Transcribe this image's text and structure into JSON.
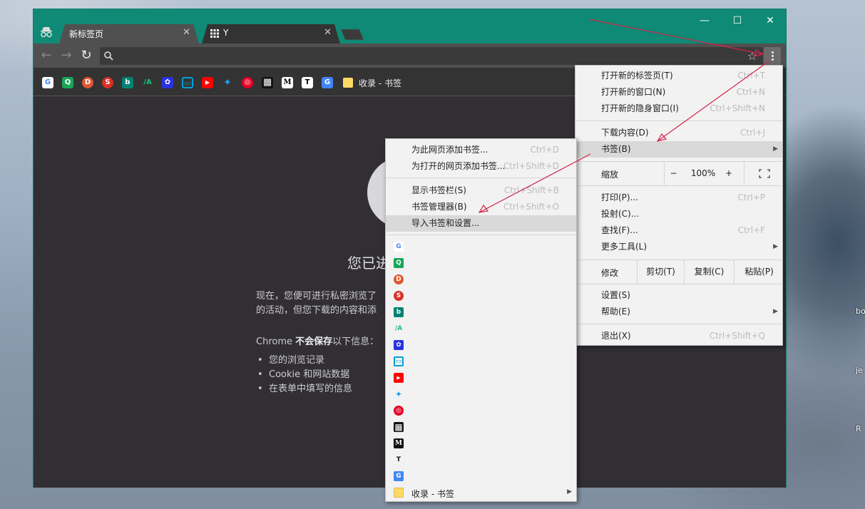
{
  "tabs": [
    {
      "title": "新标签页",
      "active": true
    },
    {
      "title": "Y",
      "active": false
    }
  ],
  "window_controls": {
    "minimize": "—",
    "maximize": "☐",
    "close": "✕"
  },
  "toolbar": {
    "back": "←",
    "forward": "→",
    "reload": "↻",
    "omnibox_value": ""
  },
  "bookmarks_bar": {
    "items": [
      {
        "icon": "google-icon",
        "glyph": "G",
        "color": "#ffffff"
      },
      {
        "icon": "green-q-icon",
        "glyph": "Q",
        "color": "#18a558"
      },
      {
        "icon": "duckduckgo-icon",
        "glyph": "D",
        "color": "#de5833"
      },
      {
        "icon": "red-s-icon",
        "glyph": "S",
        "color": "#d93025"
      },
      {
        "icon": "bing-icon",
        "glyph": "b",
        "color": "#008373"
      },
      {
        "icon": "ia-icon",
        "glyph": "/A",
        "color": "#333333"
      },
      {
        "icon": "baidu-icon",
        "glyph": "✿",
        "color": "#2932e1"
      },
      {
        "icon": "bilibili-icon",
        "glyph": "▭",
        "color": "#00a1d6"
      },
      {
        "icon": "youtube-icon",
        "glyph": "▶",
        "color": "#ff0000"
      },
      {
        "icon": "twitter-icon",
        "glyph": "✦",
        "color": "#1da1f2"
      },
      {
        "icon": "netease-music-icon",
        "glyph": "◎",
        "color": "#e60026"
      },
      {
        "icon": "grid-icon",
        "glyph": "▦",
        "color": "#111111"
      },
      {
        "icon": "medium-icon",
        "glyph": "M",
        "color": "#000000"
      },
      {
        "icon": "t-icon",
        "glyph": "T",
        "color": "#ffffff"
      },
      {
        "icon": "translate-icon",
        "glyph": "G",
        "color": "#4285f4"
      }
    ],
    "folder_label": "收录 - 书签"
  },
  "incognito_page": {
    "title": "您已进",
    "para1_line1": "现在，您便可进行私密浏览了",
    "para1_line2": "的活动，但您下载的内容和添",
    "para2_prefix": "Chrome ",
    "para2_bold": "不会保存",
    "para2_suffix": "以下信息：",
    "list": [
      "您的浏览记录",
      "Cookie 和网站数据",
      "在表单中填写的信息"
    ]
  },
  "main_menu": {
    "items": [
      {
        "label": "打开新的标签页(T)",
        "shortcut": "Ctrl+T"
      },
      {
        "label": "打开新的窗口(N)",
        "shortcut": "Ctrl+N"
      },
      {
        "label": "打开新的隐身窗口(I)",
        "shortcut": "Ctrl+Shift+N"
      },
      {
        "label": "下载内容(D)",
        "shortcut": "Ctrl+J"
      },
      {
        "label": "书签(B)",
        "shortcut": ""
      },
      {
        "label": "打印(P)...",
        "shortcut": "Ctrl+P"
      },
      {
        "label": "投射(C)...",
        "shortcut": ""
      },
      {
        "label": "查找(F)...",
        "shortcut": "Ctrl+F"
      },
      {
        "label": "更多工具(L)",
        "shortcut": ""
      },
      {
        "label": "设置(S)",
        "shortcut": ""
      },
      {
        "label": "帮助(E)",
        "shortcut": ""
      },
      {
        "label": "退出(X)",
        "shortcut": "Ctrl+Shift+Q"
      }
    ],
    "zoom": {
      "label": "缩放",
      "minus": "−",
      "value": "100%",
      "plus": "+"
    },
    "edit": {
      "label": "修改",
      "cut": "剪切(T)",
      "copy": "复制(C)",
      "paste": "粘贴(P)"
    }
  },
  "bookmark_submenu": {
    "items": [
      {
        "label": "为此网页添加书签...",
        "shortcut": "Ctrl+D"
      },
      {
        "label": "为打开的网页添加书签...",
        "shortcut": "Ctrl+Shift+D"
      },
      {
        "label": "显示书签栏(S)",
        "shortcut": "Ctrl+Shift+B"
      },
      {
        "label": "书签管理器(B)",
        "shortcut": "Ctrl+Shift+O"
      },
      {
        "label": "导入书签和设置...",
        "shortcut": ""
      }
    ],
    "folder_label": "收录 - 书签"
  },
  "desktop_labels": [
    "bo",
    "je",
    "R"
  ]
}
